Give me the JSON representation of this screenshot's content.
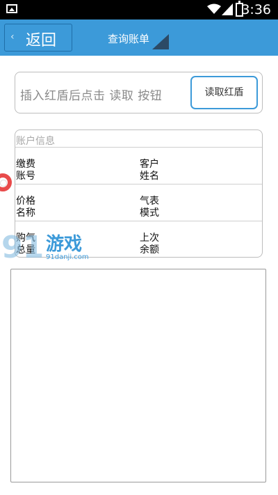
{
  "status_bar": {
    "time": "3:36"
  },
  "header": {
    "back_label": "返回",
    "back_chevron": "‹",
    "title": "查询账单"
  },
  "reader": {
    "prompt": "插入红盾后点击 读取 按钮",
    "read_button": "读取红盾"
  },
  "account_info": {
    "section_title": "账户信息",
    "fields": {
      "fee_account": [
        "缴费",
        "账号"
      ],
      "customer_name": [
        "客户",
        "姓名"
      ],
      "price_name": [
        "价格",
        "名称"
      ],
      "meter_model": [
        "气表",
        "模式"
      ],
      "gas_total": [
        "购气",
        "总量"
      ],
      "last_balance": [
        "上次",
        "余额"
      ]
    }
  },
  "watermark": {
    "number": "91",
    "name": "游戏",
    "url": "91danji.com"
  },
  "icons": {
    "image": "image-icon",
    "wifi": "wifi-icon",
    "signal": "signal-icon",
    "battery": "battery-icon",
    "dropdown": "dropdown-triangle-icon",
    "lifebuoy": "lifebuoy-icon"
  },
  "colors": {
    "accent": "#3c9ad9",
    "status_bar": "#000000"
  }
}
